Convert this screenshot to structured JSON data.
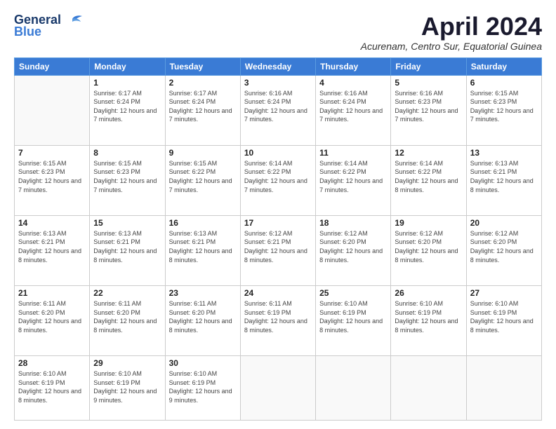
{
  "logo": {
    "line1": "General",
    "line2": "Blue"
  },
  "title": "April 2024",
  "subtitle": "Acurenam, Centro Sur, Equatorial Guinea",
  "days_of_week": [
    "Sunday",
    "Monday",
    "Tuesday",
    "Wednesday",
    "Thursday",
    "Friday",
    "Saturday"
  ],
  "weeks": [
    [
      {
        "num": "",
        "sunrise": "",
        "sunset": "",
        "daylight": ""
      },
      {
        "num": "1",
        "sunrise": "Sunrise: 6:17 AM",
        "sunset": "Sunset: 6:24 PM",
        "daylight": "Daylight: 12 hours and 7 minutes."
      },
      {
        "num": "2",
        "sunrise": "Sunrise: 6:17 AM",
        "sunset": "Sunset: 6:24 PM",
        "daylight": "Daylight: 12 hours and 7 minutes."
      },
      {
        "num": "3",
        "sunrise": "Sunrise: 6:16 AM",
        "sunset": "Sunset: 6:24 PM",
        "daylight": "Daylight: 12 hours and 7 minutes."
      },
      {
        "num": "4",
        "sunrise": "Sunrise: 6:16 AM",
        "sunset": "Sunset: 6:24 PM",
        "daylight": "Daylight: 12 hours and 7 minutes."
      },
      {
        "num": "5",
        "sunrise": "Sunrise: 6:16 AM",
        "sunset": "Sunset: 6:23 PM",
        "daylight": "Daylight: 12 hours and 7 minutes."
      },
      {
        "num": "6",
        "sunrise": "Sunrise: 6:15 AM",
        "sunset": "Sunset: 6:23 PM",
        "daylight": "Daylight: 12 hours and 7 minutes."
      }
    ],
    [
      {
        "num": "7",
        "sunrise": "Sunrise: 6:15 AM",
        "sunset": "Sunset: 6:23 PM",
        "daylight": "Daylight: 12 hours and 7 minutes."
      },
      {
        "num": "8",
        "sunrise": "Sunrise: 6:15 AM",
        "sunset": "Sunset: 6:23 PM",
        "daylight": "Daylight: 12 hours and 7 minutes."
      },
      {
        "num": "9",
        "sunrise": "Sunrise: 6:15 AM",
        "sunset": "Sunset: 6:22 PM",
        "daylight": "Daylight: 12 hours and 7 minutes."
      },
      {
        "num": "10",
        "sunrise": "Sunrise: 6:14 AM",
        "sunset": "Sunset: 6:22 PM",
        "daylight": "Daylight: 12 hours and 7 minutes."
      },
      {
        "num": "11",
        "sunrise": "Sunrise: 6:14 AM",
        "sunset": "Sunset: 6:22 PM",
        "daylight": "Daylight: 12 hours and 7 minutes."
      },
      {
        "num": "12",
        "sunrise": "Sunrise: 6:14 AM",
        "sunset": "Sunset: 6:22 PM",
        "daylight": "Daylight: 12 hours and 8 minutes."
      },
      {
        "num": "13",
        "sunrise": "Sunrise: 6:13 AM",
        "sunset": "Sunset: 6:21 PM",
        "daylight": "Daylight: 12 hours and 8 minutes."
      }
    ],
    [
      {
        "num": "14",
        "sunrise": "Sunrise: 6:13 AM",
        "sunset": "Sunset: 6:21 PM",
        "daylight": "Daylight: 12 hours and 8 minutes."
      },
      {
        "num": "15",
        "sunrise": "Sunrise: 6:13 AM",
        "sunset": "Sunset: 6:21 PM",
        "daylight": "Daylight: 12 hours and 8 minutes."
      },
      {
        "num": "16",
        "sunrise": "Sunrise: 6:13 AM",
        "sunset": "Sunset: 6:21 PM",
        "daylight": "Daylight: 12 hours and 8 minutes."
      },
      {
        "num": "17",
        "sunrise": "Sunrise: 6:12 AM",
        "sunset": "Sunset: 6:21 PM",
        "daylight": "Daylight: 12 hours and 8 minutes."
      },
      {
        "num": "18",
        "sunrise": "Sunrise: 6:12 AM",
        "sunset": "Sunset: 6:20 PM",
        "daylight": "Daylight: 12 hours and 8 minutes."
      },
      {
        "num": "19",
        "sunrise": "Sunrise: 6:12 AM",
        "sunset": "Sunset: 6:20 PM",
        "daylight": "Daylight: 12 hours and 8 minutes."
      },
      {
        "num": "20",
        "sunrise": "Sunrise: 6:12 AM",
        "sunset": "Sunset: 6:20 PM",
        "daylight": "Daylight: 12 hours and 8 minutes."
      }
    ],
    [
      {
        "num": "21",
        "sunrise": "Sunrise: 6:11 AM",
        "sunset": "Sunset: 6:20 PM",
        "daylight": "Daylight: 12 hours and 8 minutes."
      },
      {
        "num": "22",
        "sunrise": "Sunrise: 6:11 AM",
        "sunset": "Sunset: 6:20 PM",
        "daylight": "Daylight: 12 hours and 8 minutes."
      },
      {
        "num": "23",
        "sunrise": "Sunrise: 6:11 AM",
        "sunset": "Sunset: 6:20 PM",
        "daylight": "Daylight: 12 hours and 8 minutes."
      },
      {
        "num": "24",
        "sunrise": "Sunrise: 6:11 AM",
        "sunset": "Sunset: 6:19 PM",
        "daylight": "Daylight: 12 hours and 8 minutes."
      },
      {
        "num": "25",
        "sunrise": "Sunrise: 6:10 AM",
        "sunset": "Sunset: 6:19 PM",
        "daylight": "Daylight: 12 hours and 8 minutes."
      },
      {
        "num": "26",
        "sunrise": "Sunrise: 6:10 AM",
        "sunset": "Sunset: 6:19 PM",
        "daylight": "Daylight: 12 hours and 8 minutes."
      },
      {
        "num": "27",
        "sunrise": "Sunrise: 6:10 AM",
        "sunset": "Sunset: 6:19 PM",
        "daylight": "Daylight: 12 hours and 8 minutes."
      }
    ],
    [
      {
        "num": "28",
        "sunrise": "Sunrise: 6:10 AM",
        "sunset": "Sunset: 6:19 PM",
        "daylight": "Daylight: 12 hours and 8 minutes."
      },
      {
        "num": "29",
        "sunrise": "Sunrise: 6:10 AM",
        "sunset": "Sunset: 6:19 PM",
        "daylight": "Daylight: 12 hours and 9 minutes."
      },
      {
        "num": "30",
        "sunrise": "Sunrise: 6:10 AM",
        "sunset": "Sunset: 6:19 PM",
        "daylight": "Daylight: 12 hours and 9 minutes."
      },
      {
        "num": "",
        "sunrise": "",
        "sunset": "",
        "daylight": ""
      },
      {
        "num": "",
        "sunrise": "",
        "sunset": "",
        "daylight": ""
      },
      {
        "num": "",
        "sunrise": "",
        "sunset": "",
        "daylight": ""
      },
      {
        "num": "",
        "sunrise": "",
        "sunset": "",
        "daylight": ""
      }
    ]
  ]
}
